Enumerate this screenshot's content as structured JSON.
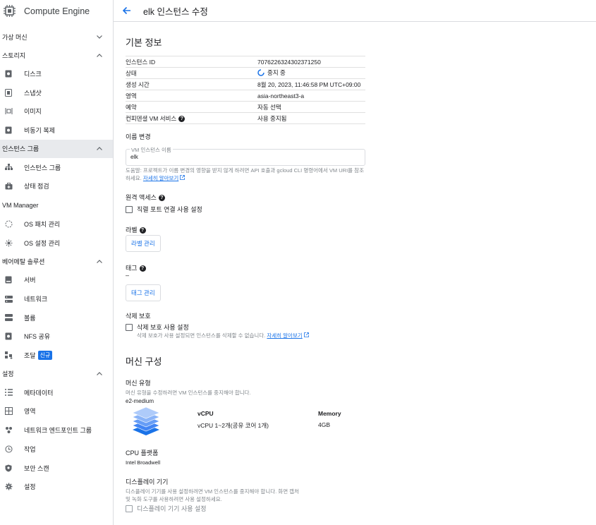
{
  "app": {
    "title": "Compute Engine"
  },
  "header": {
    "title": "elk 인스턴스 수정"
  },
  "sidebar": {
    "sections": [
      {
        "label": "가상 머신",
        "expanded": false,
        "items": []
      },
      {
        "label": "스토리지",
        "expanded": true,
        "items": [
          {
            "label": "디스크",
            "icon": "disk-icon"
          },
          {
            "label": "스냅샷",
            "icon": "snapshot-icon"
          },
          {
            "label": "이미지",
            "icon": "image-icon"
          },
          {
            "label": "비동기 복제",
            "icon": "async-replication-icon"
          }
        ]
      },
      {
        "label": "인스턴스 그룹",
        "expanded": true,
        "active": true,
        "items": [
          {
            "label": "인스턴스 그룹",
            "icon": "instance-group-icon"
          },
          {
            "label": "상태 점검",
            "icon": "health-check-icon"
          }
        ]
      },
      {
        "label": "VM Manager",
        "expanded": false,
        "items": [
          {
            "label": "OS 패치 관리",
            "icon": "patch-icon"
          },
          {
            "label": "OS 설정 관리",
            "icon": "os-config-icon"
          }
        ]
      },
      {
        "label": "베어메탈 솔루션",
        "expanded": true,
        "items": [
          {
            "label": "서버",
            "icon": "server-icon"
          },
          {
            "label": "네트워크",
            "icon": "network-icon"
          },
          {
            "label": "볼륨",
            "icon": "volume-icon"
          },
          {
            "label": "NFS 공유",
            "icon": "nfs-icon"
          },
          {
            "label": "조달",
            "icon": "procurement-icon",
            "badge": "신규"
          }
        ]
      },
      {
        "label": "설정",
        "expanded": true,
        "items": [
          {
            "label": "메타데이터",
            "icon": "metadata-icon"
          },
          {
            "label": "영역",
            "icon": "zones-icon"
          },
          {
            "label": "네트워크 엔드포인트 그룹",
            "icon": "endpoint-group-icon"
          },
          {
            "label": "작업",
            "icon": "operations-icon"
          },
          {
            "label": "보안 스캔",
            "icon": "security-scan-icon"
          },
          {
            "label": "설정",
            "icon": "settings-icon"
          }
        ]
      }
    ]
  },
  "basic": {
    "title": "기본 정보",
    "rows": [
      {
        "key": "인스턴스 ID",
        "value": "7076226324302371250"
      },
      {
        "key": "상태",
        "value": "중지 중"
      },
      {
        "key": "생성 시간",
        "value": "8월 20, 2023, 11:46:58 PM UTC+09:00"
      },
      {
        "key": "영역",
        "value": "asia-northeast3-a"
      },
      {
        "key": "예약",
        "value": "자동 선택"
      },
      {
        "key": "컨피덴셜 VM 서비스",
        "value": "사용 중지됨"
      }
    ]
  },
  "rename": {
    "title": "이름 변경",
    "field_label": "VM 인스턴스 이름",
    "field_value": "elk",
    "help": "도움말: 프로젝트가 이름 변경의 영향을 받지 않게 하려면 API 호출과 gcloud CLI 명령어에서 VM URI를 참조하세요.",
    "link": "자세히 알아보기"
  },
  "remote": {
    "title": "원격 액세스",
    "checkbox": "직렬 포트 연결 사용 설정"
  },
  "labels": {
    "title": "라벨",
    "button": "라벨 관리"
  },
  "tags": {
    "title": "태그",
    "value": "–",
    "button": "태그 관리"
  },
  "deletion": {
    "title": "삭제 보호",
    "checkbox": "삭제 보호 사용 설정",
    "help": "삭제 보호가 사용 설정되면 인스턴스를 삭제할 수 없습니다.",
    "link": "자세히 알아보기"
  },
  "machine": {
    "title": "머신 구성",
    "type_label": "머신 유형",
    "type_help": "머신 유형을 수정하려면 VM 인스턴스를 중지해야 합니다.",
    "type_value": "e2-medium",
    "vcpu_header": "vCPU",
    "vcpu_value": "vCPU 1~2개(공유 코어 1개)",
    "memory_header": "Memory",
    "memory_value": "4GB",
    "cpu_platform_label": "CPU 플랫폼",
    "cpu_platform_value": "Intel Broadwell"
  },
  "display": {
    "title": "디스플레이 기기",
    "help": "디스플레이 기기를 사용 설정하려면 VM 인스턴스를 중지해야 합니다. 화면 캡처 및 녹화 도구를 사용하려면 사용 설정하세요.",
    "checkbox": "디스플레이 기기 사용 설정"
  },
  "colors": {
    "accent": "#1a73e8",
    "active_bg": "#e8eaed",
    "border": "#dadce0"
  }
}
